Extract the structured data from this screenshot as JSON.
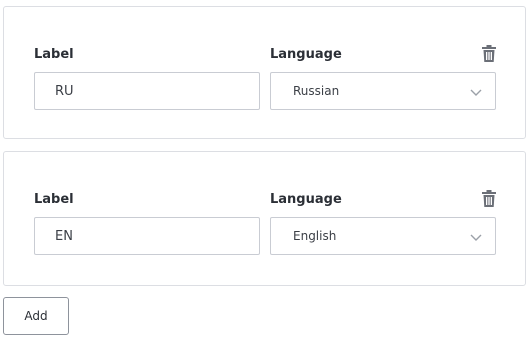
{
  "rows": [
    {
      "label_heading": "Label",
      "language_heading": "Language",
      "label_value": "RU",
      "language_value": "Russian",
      "delete_icon": "trash-icon",
      "chevron_icon": "chevron-down-icon"
    },
    {
      "label_heading": "Label",
      "language_heading": "Language",
      "label_value": "EN",
      "language_value": "English",
      "delete_icon": "trash-icon",
      "chevron_icon": "chevron-down-icon"
    }
  ],
  "add_button_label": "Add",
  "colors": {
    "border": "#dcdee3",
    "input_border": "#c9ccd3",
    "icon": "#6b6f77",
    "text": "#2b2f36"
  }
}
